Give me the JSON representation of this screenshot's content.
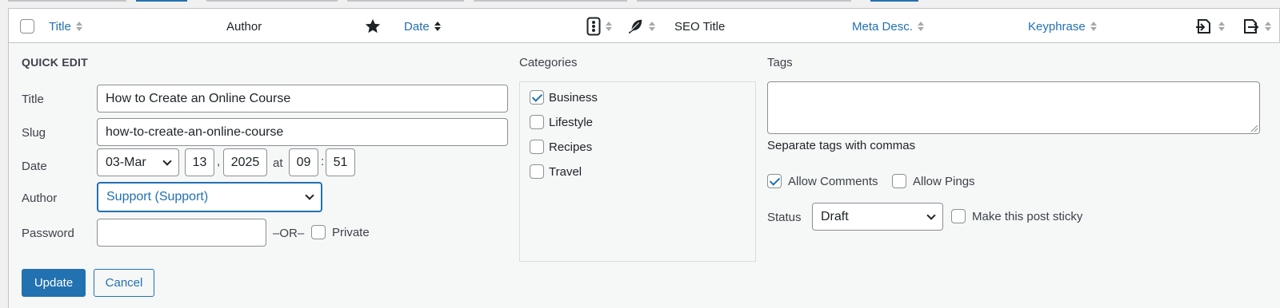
{
  "header": {
    "title": "Title",
    "author": "Author",
    "date": "Date",
    "seo_title": "SEO Title",
    "meta_desc": "Meta Desc.",
    "keyphrase": "Keyphrase"
  },
  "quick_edit": {
    "heading": "QUICK EDIT",
    "title_label": "Title",
    "title_value": "How to Create an Online Course",
    "slug_label": "Slug",
    "slug_value": "how-to-create-an-online-course",
    "date_label": "Date",
    "month": "03-Mar",
    "day": "13",
    "comma": ",",
    "year": "2025",
    "at": "at",
    "hour": "09",
    "colon": ":",
    "minute": "51",
    "author_label": "Author",
    "author_value": "Support (Support)",
    "password_label": "Password",
    "password_value": "",
    "or_text": "–OR–",
    "private_label": "Private",
    "private_checked": false
  },
  "categories": {
    "label": "Categories",
    "items": [
      {
        "label": "Business",
        "checked": true
      },
      {
        "label": "Lifestyle",
        "checked": false
      },
      {
        "label": "Recipes",
        "checked": false
      },
      {
        "label": "Travel",
        "checked": false
      }
    ]
  },
  "tags": {
    "label": "Tags",
    "value": "",
    "hint": "Separate tags with commas"
  },
  "options": {
    "allow_comments_label": "Allow Comments",
    "allow_comments": true,
    "allow_pings_label": "Allow Pings",
    "allow_pings": false,
    "status_label": "Status",
    "status_value": "Draft",
    "sticky_label": "Make this post sticky",
    "sticky": false
  },
  "actions": {
    "update": "Update",
    "cancel": "Cancel"
  },
  "colors": {
    "accent": "#2271b1",
    "panel_bg": "#f6f7f7",
    "header_bg": "#ffffff"
  }
}
